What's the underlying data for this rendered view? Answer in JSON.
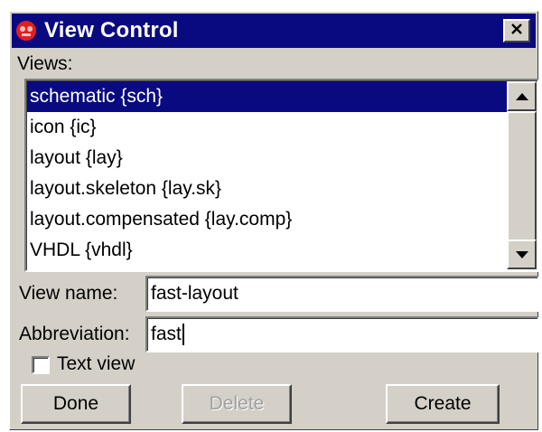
{
  "window": {
    "title": "View Control",
    "colors": {
      "titlebar": "#0a0a80",
      "face": "#d4d0c8",
      "selection": "#0a0a80",
      "app_icon": "#e02020"
    }
  },
  "views": {
    "label": "Views:",
    "items": [
      {
        "label": "schematic {sch}",
        "selected": true
      },
      {
        "label": "icon {ic}",
        "selected": false
      },
      {
        "label": "layout {lay}",
        "selected": false
      },
      {
        "label": "layout.skeleton {lay.sk}",
        "selected": false
      },
      {
        "label": "layout.compensated {lay.comp}",
        "selected": false
      },
      {
        "label": "VHDL {vhdl}",
        "selected": false
      }
    ]
  },
  "view_name": {
    "label": "View name:",
    "value": "fast-layout"
  },
  "abbreviation": {
    "label": "Abbreviation:",
    "value": "fast"
  },
  "text_view": {
    "label": "Text view",
    "checked": false
  },
  "buttons": {
    "done": "Done",
    "delete": "Delete",
    "create": "Create"
  },
  "icons": {
    "app": "app-icon",
    "close": "close-icon",
    "scroll_up": "scroll-up-arrow-icon",
    "scroll_down": "scroll-down-arrow-icon"
  }
}
